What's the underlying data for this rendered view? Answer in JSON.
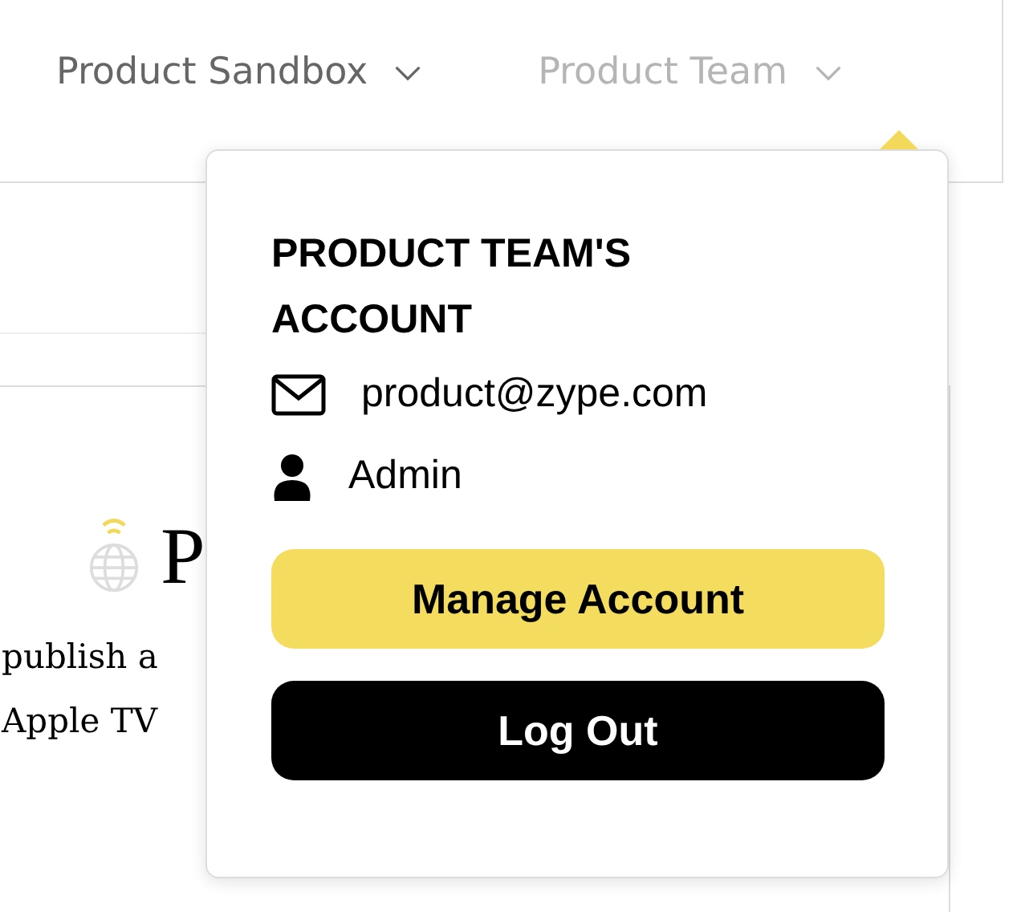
{
  "nav": [
    {
      "label": "Product Sandbox",
      "selected": false
    },
    {
      "label": "Product Team",
      "selected": true
    }
  ],
  "content": {
    "heading": "P",
    "lines": [
      "publish a",
      "Apple TV"
    ]
  },
  "account_menu": {
    "title": "PRODUCT TEAM'S ACCOUNT",
    "email": "product@zype.com",
    "role": "Admin",
    "buttons": [
      {
        "label": "Manage Account",
        "kind": "primary"
      },
      {
        "label": "Log Out",
        "kind": "dark"
      }
    ]
  }
}
